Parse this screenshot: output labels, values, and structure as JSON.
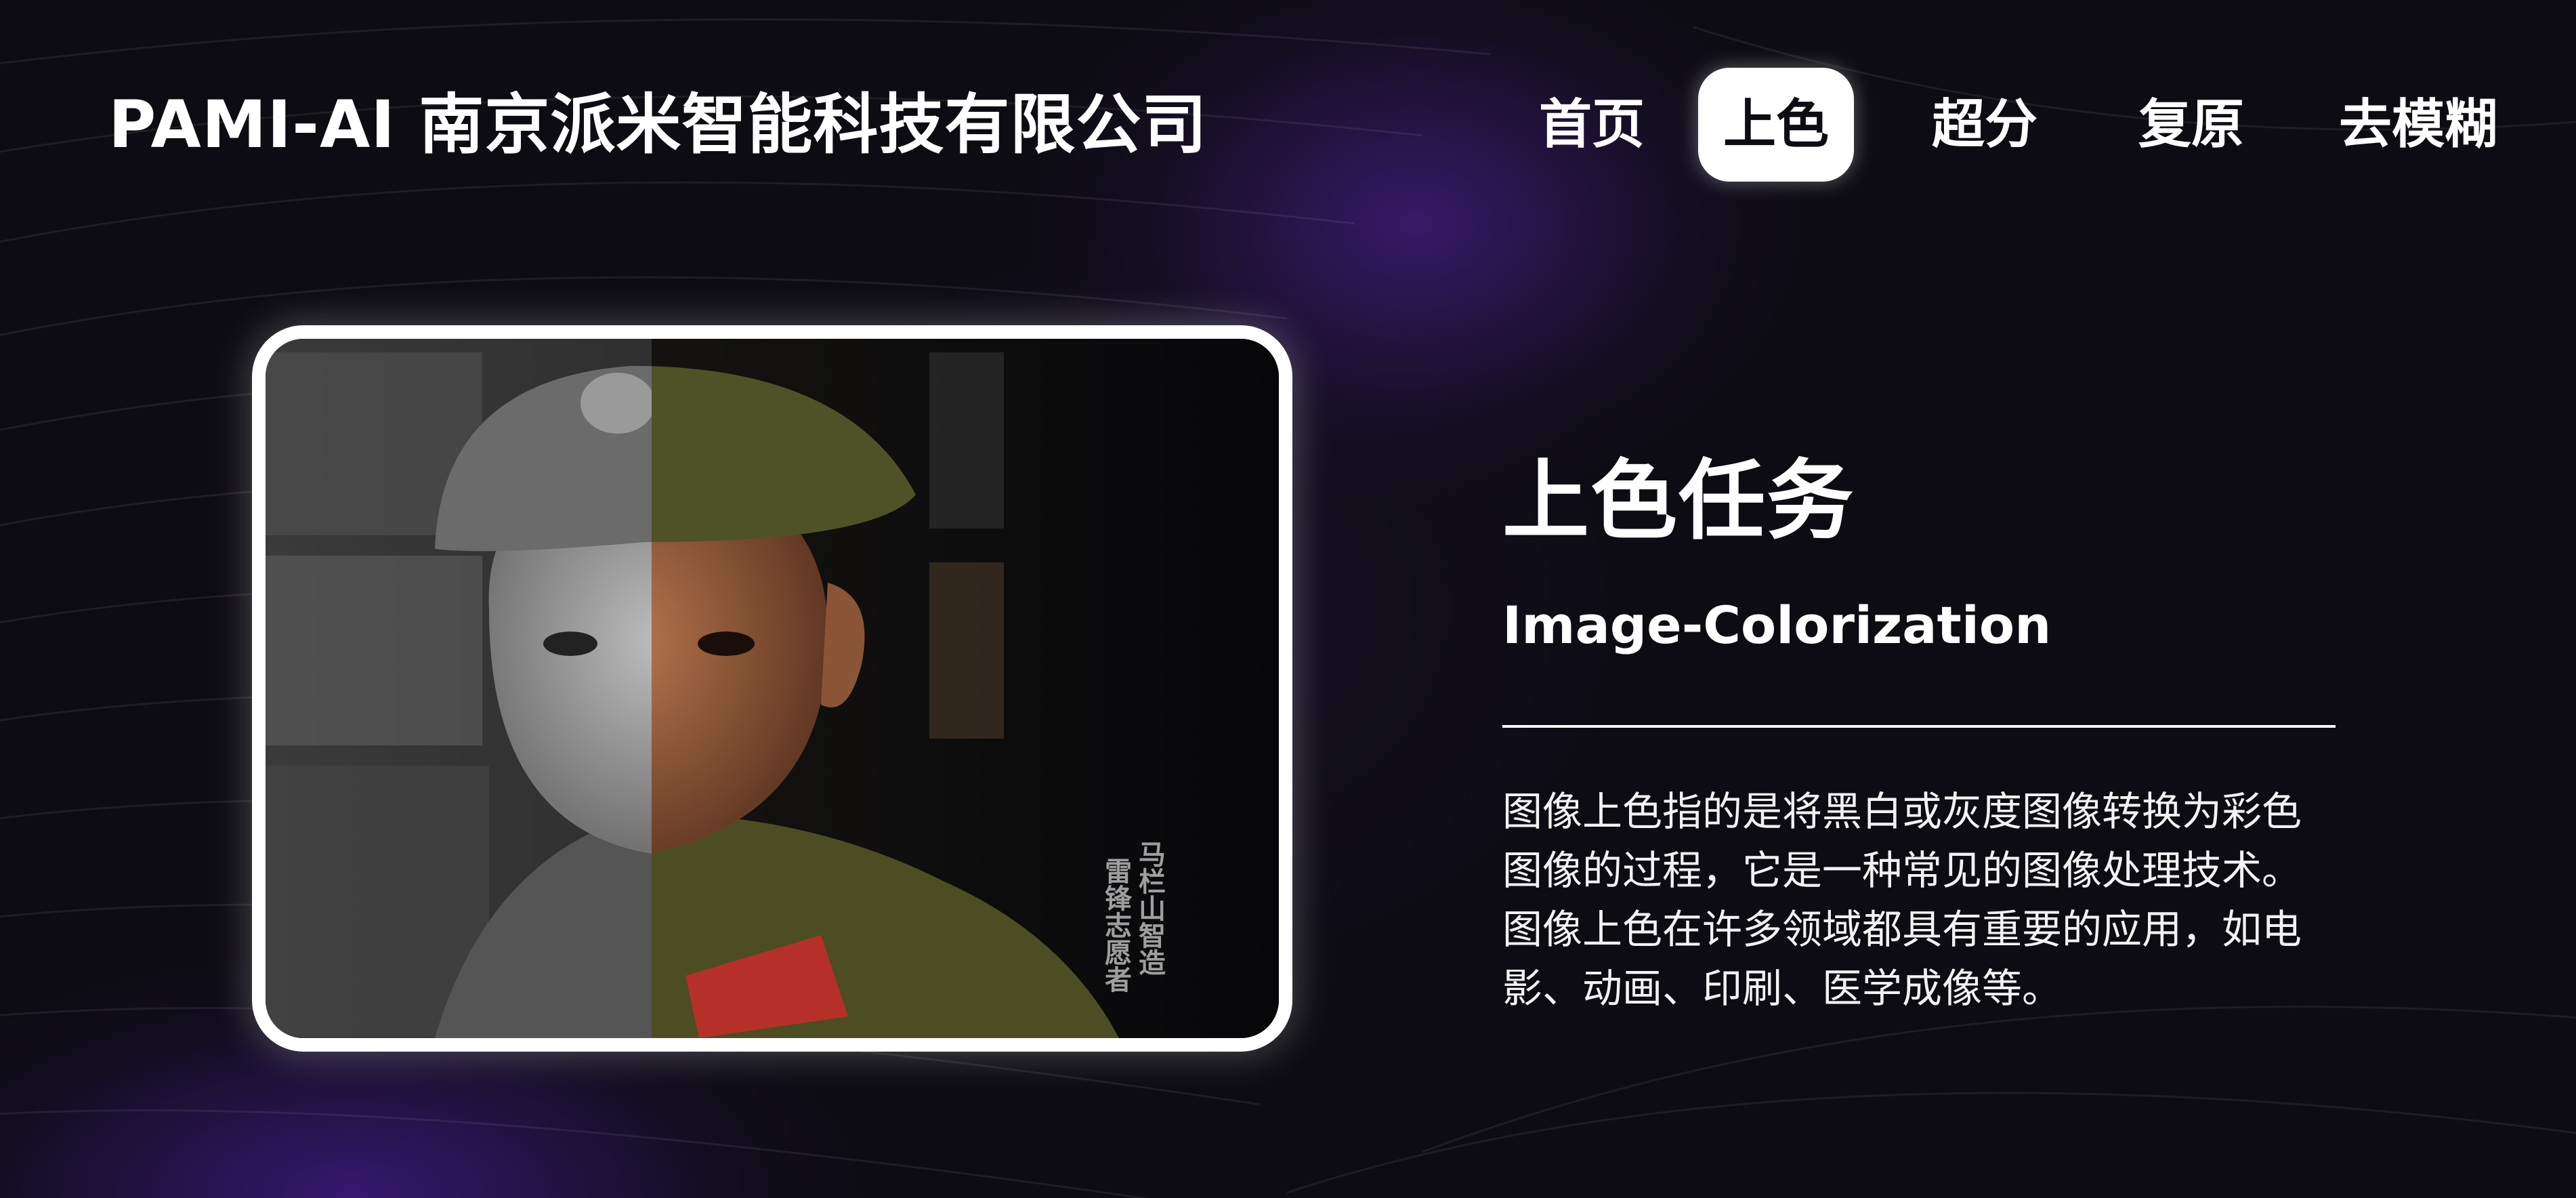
{
  "header": {
    "brand": "PAMI-AI 南京派米智能科技有限公司"
  },
  "nav": {
    "items": [
      {
        "label": "首页",
        "active": false
      },
      {
        "label": "上色",
        "active": true
      },
      {
        "label": "超分",
        "active": false
      },
      {
        "label": "复原",
        "active": false
      },
      {
        "label": "去模糊",
        "active": false
      }
    ]
  },
  "main": {
    "image": {
      "description_icon": "image-colorization-example",
      "caption": "马栏山智造 雷锋志愿者"
    },
    "title": "上色任务",
    "subtitle": "Image-Colorization",
    "description": "图像上色指的是将黑白或灰度图像转换为彩色图像的过程，它是一种常见的图像处理技术。 图像上色在许多领域都具有重要的应用，如电影、动画、印刷、医学成像等。"
  },
  "colors": {
    "background": "#0d0c12",
    "accent_purple": "#3b1d78",
    "text": "#ffffff"
  }
}
